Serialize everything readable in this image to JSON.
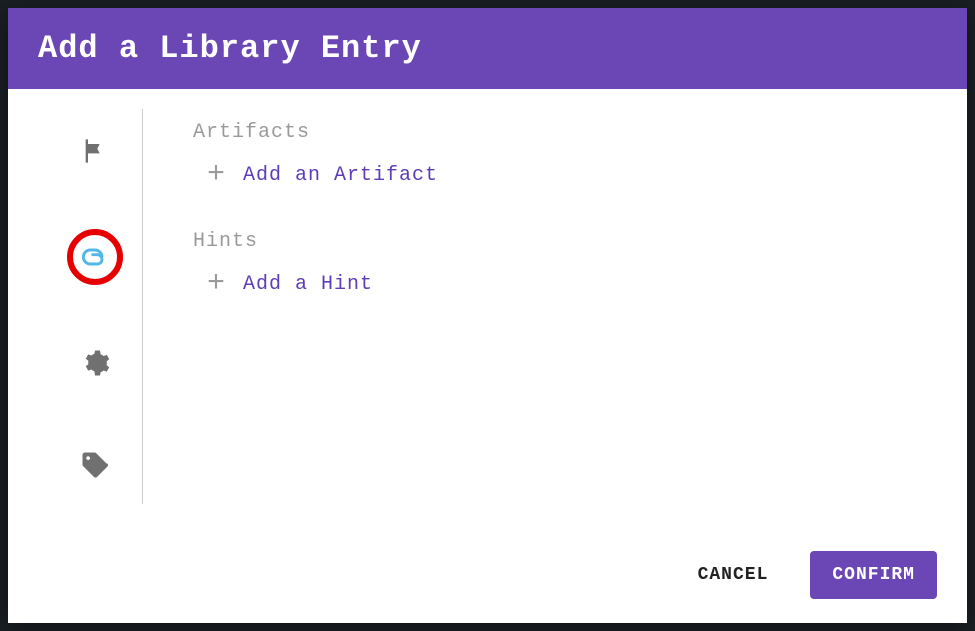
{
  "modal": {
    "title": "Add a Library Entry"
  },
  "sidebar": {
    "items": [
      {
        "name": "flag",
        "active": false
      },
      {
        "name": "attachment",
        "active": true
      },
      {
        "name": "settings",
        "active": false
      },
      {
        "name": "tag",
        "active": false
      }
    ]
  },
  "sections": {
    "artifacts": {
      "title": "Artifacts",
      "addLabel": "Add an Artifact"
    },
    "hints": {
      "title": "Hints",
      "addLabel": "Add a Hint"
    }
  },
  "footer": {
    "cancelLabel": "CANCEL",
    "confirmLabel": "CONFIRM"
  }
}
